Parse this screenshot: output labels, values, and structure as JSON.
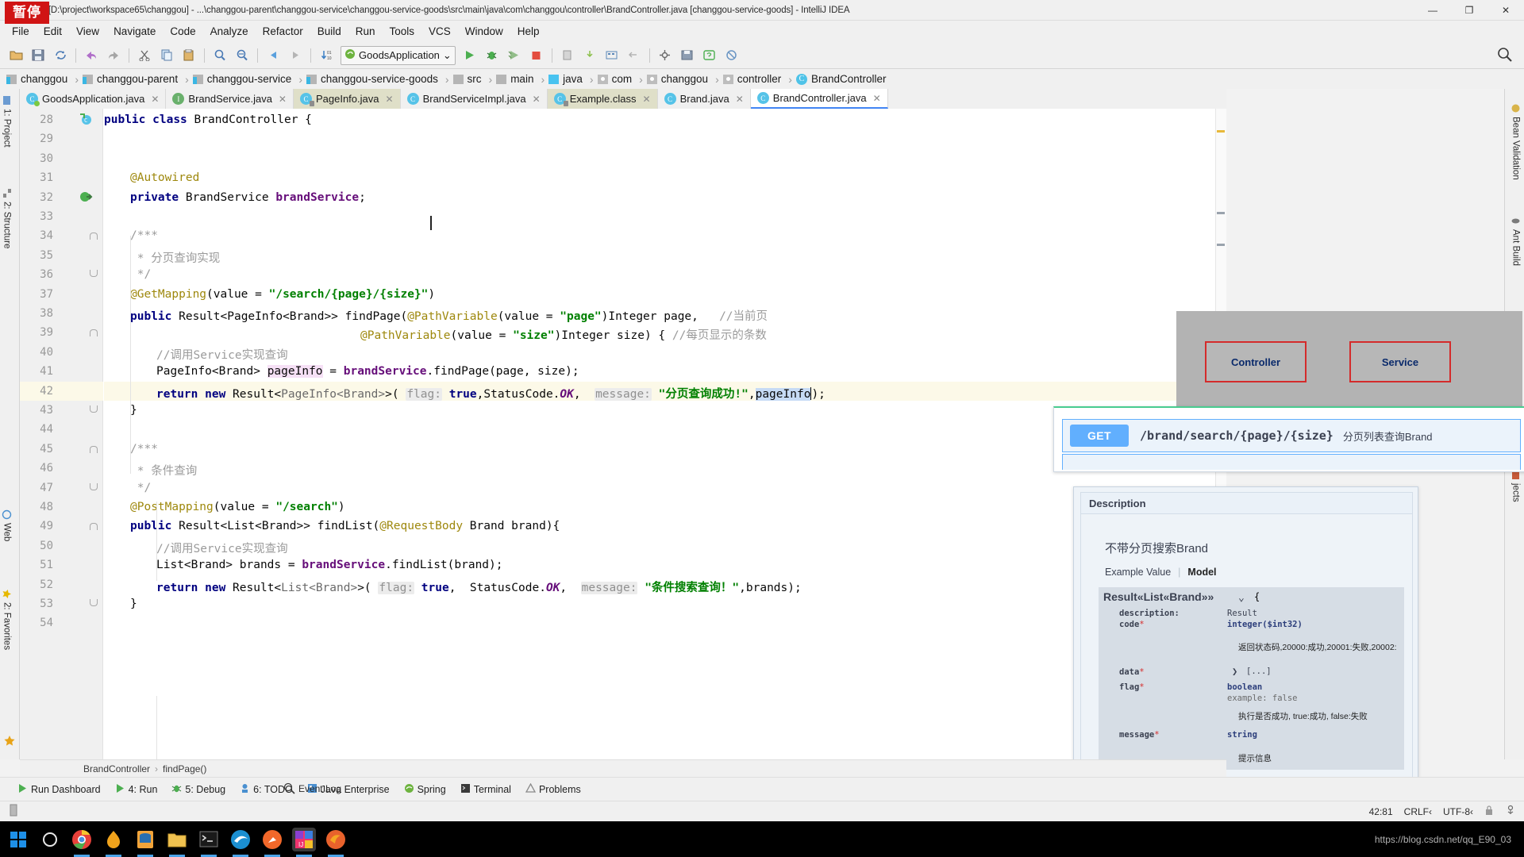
{
  "window": {
    "title": "changgou [D:\\project\\workspace65\\changgou] - ...\\changgou-parent\\changgou-service\\changgou-service-goods\\src\\main\\java\\com\\changgou\\controller\\BrandController.java [changgou-service-goods] - IntelliJ IDEA",
    "pause_badge": "暂停",
    "minimize": "—",
    "maximize": "❐",
    "close": "✕"
  },
  "menu": [
    "File",
    "Edit",
    "View",
    "Navigate",
    "Code",
    "Analyze",
    "Refactor",
    "Build",
    "Run",
    "Tools",
    "VCS",
    "Window",
    "Help"
  ],
  "toolbar": {
    "run_config": "GoodsApplication",
    "run_config_caret": "⌄"
  },
  "breadcrumb": [
    {
      "label": "changgou",
      "icon": "module-icon"
    },
    {
      "label": "changgou-parent",
      "icon": "module-icon"
    },
    {
      "label": "changgou-service",
      "icon": "module-icon"
    },
    {
      "label": "changgou-service-goods",
      "icon": "module-icon"
    },
    {
      "label": "src",
      "icon": "folder-icon"
    },
    {
      "label": "main",
      "icon": "folder-icon"
    },
    {
      "label": "java",
      "icon": "source-folder-icon"
    },
    {
      "label": "com",
      "icon": "package-icon"
    },
    {
      "label": "changgou",
      "icon": "package-icon"
    },
    {
      "label": "controller",
      "icon": "package-icon"
    },
    {
      "label": "BrandController",
      "icon": "class-icon"
    }
  ],
  "tabs": [
    {
      "label": "GoodsApplication.java",
      "icon": "spring-class-icon",
      "letter": "C",
      "state": "normal"
    },
    {
      "label": "BrandService.java",
      "icon": "interface-icon",
      "letter": "I",
      "state": "normal"
    },
    {
      "label": "PageInfo.java",
      "icon": "class-locked-icon",
      "letter": "C",
      "state": "highlight"
    },
    {
      "label": "BrandServiceImpl.java",
      "icon": "class-icon",
      "letter": "C",
      "state": "normal"
    },
    {
      "label": "Example.class",
      "icon": "class-locked-icon",
      "letter": "C",
      "state": "highlight"
    },
    {
      "label": "Brand.java",
      "icon": "class-icon",
      "letter": "C",
      "state": "normal"
    },
    {
      "label": "BrandController.java",
      "icon": "class-icon",
      "letter": "C",
      "state": "active"
    }
  ],
  "left_tools": [
    {
      "label": "1: Project",
      "icon": "project-icon"
    },
    {
      "label": "2: Structure",
      "icon": "structure-icon"
    },
    {
      "label": "Web",
      "icon": "web-icon"
    },
    {
      "label": "2: Favorites",
      "icon": "favorites-icon"
    }
  ],
  "right_tools": [
    {
      "label": "Bean Validation",
      "icon": "bean-icon"
    },
    {
      "label": "Ant Build",
      "icon": "ant-icon"
    },
    {
      "label": "jects",
      "icon": "maven-icon"
    }
  ],
  "editor": {
    "first_line": 28,
    "lines": [
      {
        "n": 28,
        "indent": 0,
        "tokens": [
          {
            "t": "public",
            "c": "kw"
          },
          {
            "t": " ",
            "c": ""
          },
          {
            "t": "class",
            "c": "kw"
          },
          {
            "t": " BrandController {",
            "c": ""
          }
        ],
        "gutter": "class-marker"
      },
      {
        "n": 29,
        "indent": 0,
        "tokens": []
      },
      {
        "n": 30,
        "indent": 0,
        "tokens": []
      },
      {
        "n": 31,
        "indent": 1,
        "tokens": [
          {
            "t": "@Autowired",
            "c": "anno"
          }
        ]
      },
      {
        "n": 32,
        "indent": 1,
        "tokens": [
          {
            "t": "private",
            "c": "kw"
          },
          {
            "t": " BrandService ",
            "c": ""
          },
          {
            "t": "brandService",
            "c": "fld"
          },
          {
            "t": ";",
            "c": ""
          }
        ],
        "gutter": "implementing-marker"
      },
      {
        "n": 33,
        "indent": 0,
        "tokens": []
      },
      {
        "n": 34,
        "indent": 1,
        "tokens": [
          {
            "t": "/***",
            "c": "cmt"
          }
        ],
        "fold": "top"
      },
      {
        "n": 35,
        "indent": 1,
        "tokens": [
          {
            "t": " * 分页查询实现",
            "c": "cmt"
          }
        ]
      },
      {
        "n": 36,
        "indent": 1,
        "tokens": [
          {
            "t": " */",
            "c": "cmt"
          }
        ],
        "fold": "bottom"
      },
      {
        "n": 37,
        "indent": 1,
        "tokens": [
          {
            "t": "@GetMapping",
            "c": "anno"
          },
          {
            "t": "(value = ",
            "c": ""
          },
          {
            "t": "\"/search/{page}/{size}\"",
            "c": "str"
          },
          {
            "t": ")",
            "c": ""
          }
        ]
      },
      {
        "n": 38,
        "indent": 1,
        "tokens": [
          {
            "t": "public",
            "c": "kw"
          },
          {
            "t": " Result<PageInfo<Brand>> findPage(",
            "c": ""
          },
          {
            "t": "@PathVariable",
            "c": "anno"
          },
          {
            "t": "(value = ",
            "c": ""
          },
          {
            "t": "\"page\"",
            "c": "str"
          },
          {
            "t": ")Integer page,   ",
            "c": ""
          },
          {
            "t": "//当前页",
            "c": "cmt"
          }
        ]
      },
      {
        "n": 39,
        "indent": 0,
        "tokens": [
          {
            "t": "                                     ",
            "c": ""
          },
          {
            "t": "@PathVariable",
            "c": "anno"
          },
          {
            "t": "(value = ",
            "c": ""
          },
          {
            "t": "\"size\"",
            "c": "str"
          },
          {
            "t": ")Integer size) { ",
            "c": ""
          },
          {
            "t": "//每页显示的条数",
            "c": "cmt"
          }
        ],
        "fold": "top"
      },
      {
        "n": 40,
        "indent": 2,
        "tokens": [
          {
            "t": "//调用Service实现查询",
            "c": "cmt"
          }
        ]
      },
      {
        "n": 41,
        "indent": 2,
        "tokens": [
          {
            "t": "PageInfo<Brand> ",
            "c": ""
          },
          {
            "t": "pageInfo",
            "c": "sel"
          },
          {
            "t": " = ",
            "c": ""
          },
          {
            "t": "brandService",
            "c": "fld"
          },
          {
            "t": ".findPage(page, size);",
            "c": ""
          }
        ]
      },
      {
        "n": 42,
        "indent": 2,
        "highlight": true,
        "tokens": [
          {
            "t": "return",
            "c": "kw"
          },
          {
            "t": " ",
            "c": ""
          },
          {
            "t": "new",
            "c": "kw"
          },
          {
            "t": " Result<",
            "c": ""
          },
          {
            "t": "PageInfo<Brand>",
            "c": "gen"
          },
          {
            "t": ">( ",
            "c": ""
          },
          {
            "t": "flag:",
            "c": "hint"
          },
          {
            "t": " ",
            "c": ""
          },
          {
            "t": "true",
            "c": "kw"
          },
          {
            "t": ",StatusCode.",
            "c": ""
          },
          {
            "t": "OK",
            "c": "stat"
          },
          {
            "t": ",  ",
            "c": ""
          },
          {
            "t": "message:",
            "c": "hint"
          },
          {
            "t": " ",
            "c": ""
          },
          {
            "t": "\"分页查询成功!\"",
            "c": "str"
          },
          {
            "t": ",",
            "c": ""
          },
          {
            "t": "pageInfo",
            "c": "selb"
          },
          {
            "t": ");",
            "c": ""
          }
        ]
      },
      {
        "n": 43,
        "indent": 1,
        "tokens": [
          {
            "t": "}",
            "c": ""
          }
        ],
        "fold": "bottom"
      },
      {
        "n": 44,
        "indent": 0,
        "tokens": []
      },
      {
        "n": 45,
        "indent": 1,
        "tokens": [
          {
            "t": "/***",
            "c": "cmt"
          }
        ],
        "fold": "top"
      },
      {
        "n": 46,
        "indent": 1,
        "tokens": [
          {
            "t": " * 条件查询",
            "c": "cmt"
          }
        ]
      },
      {
        "n": 47,
        "indent": 1,
        "tokens": [
          {
            "t": " */",
            "c": "cmt"
          }
        ],
        "fold": "bottom"
      },
      {
        "n": 48,
        "indent": 1,
        "tokens": [
          {
            "t": "@PostMapping",
            "c": "anno"
          },
          {
            "t": "(value = ",
            "c": ""
          },
          {
            "t": "\"/search\"",
            "c": "str"
          },
          {
            "t": ")",
            "c": ""
          }
        ]
      },
      {
        "n": 49,
        "indent": 1,
        "tokens": [
          {
            "t": "public",
            "c": "kw"
          },
          {
            "t": " Result<List<Brand>> findList(",
            "c": ""
          },
          {
            "t": "@RequestBody",
            "c": "anno"
          },
          {
            "t": " Brand brand){",
            "c": ""
          }
        ],
        "fold": "top"
      },
      {
        "n": 50,
        "indent": 2,
        "tokens": [
          {
            "t": "//调用Service实现查询",
            "c": "cmt"
          }
        ]
      },
      {
        "n": 51,
        "indent": 2,
        "tokens": [
          {
            "t": "List<Brand> brands = ",
            "c": ""
          },
          {
            "t": "brandService",
            "c": "fld"
          },
          {
            "t": ".findList(brand);",
            "c": ""
          }
        ]
      },
      {
        "n": 52,
        "indent": 2,
        "tokens": [
          {
            "t": "return",
            "c": "kw"
          },
          {
            "t": " ",
            "c": ""
          },
          {
            "t": "new",
            "c": "kw"
          },
          {
            "t": " Result<",
            "c": ""
          },
          {
            "t": "List<Brand>",
            "c": "gen"
          },
          {
            "t": ">( ",
            "c": ""
          },
          {
            "t": "flag:",
            "c": "hint"
          },
          {
            "t": " ",
            "c": ""
          },
          {
            "t": "true",
            "c": "kw"
          },
          {
            "t": ",  StatusCode.",
            "c": ""
          },
          {
            "t": "OK",
            "c": "stat"
          },
          {
            "t": ",  ",
            "c": ""
          },
          {
            "t": "message:",
            "c": "hint"
          },
          {
            "t": " ",
            "c": ""
          },
          {
            "t": "\"条件搜索查询！\"",
            "c": "str"
          },
          {
            "t": ",brands);",
            "c": ""
          }
        ]
      },
      {
        "n": 53,
        "indent": 1,
        "tokens": [
          {
            "t": "}",
            "c": ""
          }
        ],
        "fold": "bottom"
      },
      {
        "n": 54,
        "indent": 0,
        "tokens": []
      }
    ]
  },
  "navigation_bar": {
    "class": "BrandController",
    "separator": "›",
    "method": "findPage()"
  },
  "tool_windows": [
    {
      "label": "Run Dashboard",
      "icon": "run-dashboard-icon"
    },
    {
      "label": "4: Run",
      "icon": "run-icon"
    },
    {
      "label": "5: Debug",
      "icon": "debug-icon"
    },
    {
      "label": "6: TODO",
      "icon": "todo-icon"
    },
    {
      "label": "Java Enterprise",
      "icon": "java-enterprise-icon"
    },
    {
      "label": "Spring",
      "icon": "spring-icon"
    },
    {
      "label": "Terminal",
      "icon": "terminal-icon"
    },
    {
      "label": "Problems",
      "icon": "problems-icon"
    }
  ],
  "status_bar": {
    "event_log": "Event Log",
    "caret_position": "42:81",
    "line_separator": "CRLF‹",
    "encoding": "UTF-8‹",
    "lock_icon": "lock-icon",
    "inspection_icon": "inspection-icon"
  },
  "diagram": {
    "boxes": [
      {
        "label": "Controller",
        "color": "#d42b2b"
      },
      {
        "label": "Service",
        "color": "#d42b2b"
      }
    ]
  },
  "swagger": {
    "operation": {
      "method": "GET",
      "path": "/brand/search/{page}/{size}",
      "summary": "分页列表查询Brand",
      "method_color": "#61affe"
    },
    "description_panel": {
      "title": "Description",
      "text": "不带分页搜索Brand",
      "tab_example": "Example Value",
      "tab_divider": "|",
      "tab_model": "Model",
      "model": {
        "title": "Result«List«Brand»»",
        "chevron": "⌄",
        "open_brace": "{",
        "close_brace": "}",
        "fields": [
          {
            "name": "description:",
            "required": false,
            "type": "Result",
            "typeclass": "plain",
            "desc": ""
          },
          {
            "name": "code",
            "required": true,
            "type": "integer($int32)",
            "typeclass": "bold",
            "desc": "返回状态码,20000:成功,20001:失败,20002:"
          },
          {
            "name": "data",
            "required": true,
            "type": "[...]",
            "typeclass": "expand",
            "desc": ""
          },
          {
            "name": "flag",
            "required": true,
            "type": "boolean",
            "typeclass": "bold",
            "example": "example: false",
            "desc": "执行是否成功, true:成功, false:失败"
          },
          {
            "name": "message",
            "required": true,
            "type": "string",
            "typeclass": "bold",
            "desc": "提示信息"
          }
        ]
      }
    }
  },
  "taskbar": {
    "items": [
      {
        "icon": "windows-start-icon",
        "active": false
      },
      {
        "icon": "cortana-search-icon",
        "active": false
      },
      {
        "icon": "chrome-icon",
        "active": true
      },
      {
        "icon": "flame-browser-icon",
        "active": true
      },
      {
        "icon": "navicat-icon",
        "active": true
      },
      {
        "icon": "file-explorer-icon",
        "active": true
      },
      {
        "icon": "command-prompt-icon",
        "active": true
      },
      {
        "icon": "edge-icon",
        "active": true
      },
      {
        "icon": "postman-icon",
        "active": true
      },
      {
        "icon": "intellij-idea-icon",
        "active": true
      },
      {
        "icon": "firefox-icon",
        "active": true
      }
    ],
    "watermark": "https://blog.csdn.net/qq_E90_03"
  }
}
